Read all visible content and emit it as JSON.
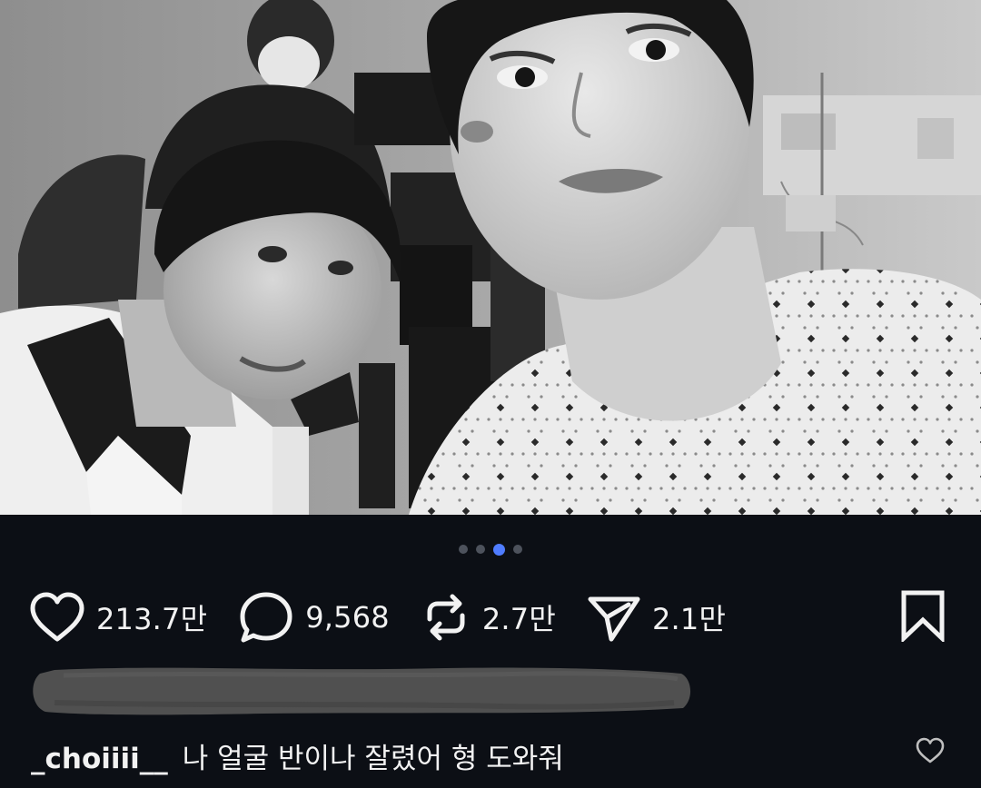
{
  "photo": {
    "description": "",
    "carousel": {
      "total": 4,
      "active_index": 2
    }
  },
  "actions": {
    "likes": "213.7만",
    "comments": "9,568",
    "reposts": "2.7만",
    "shares": "2.1만"
  },
  "caption": {
    "username": "_choiiii__",
    "text": "나 얼굴 반이나 잘렸어 형 도와줘"
  },
  "colors": {
    "background": "#0c0f15",
    "active_dot": "#4f7cff",
    "inactive_dot": "#4d525c",
    "text": "#f2f2f2"
  },
  "icons": {
    "like": "heart-icon",
    "comment": "comment-bubble-icon",
    "repost": "repost-icon",
    "share": "share-send-icon",
    "save": "bookmark-icon",
    "caption_like": "heart-outline-small-icon"
  }
}
